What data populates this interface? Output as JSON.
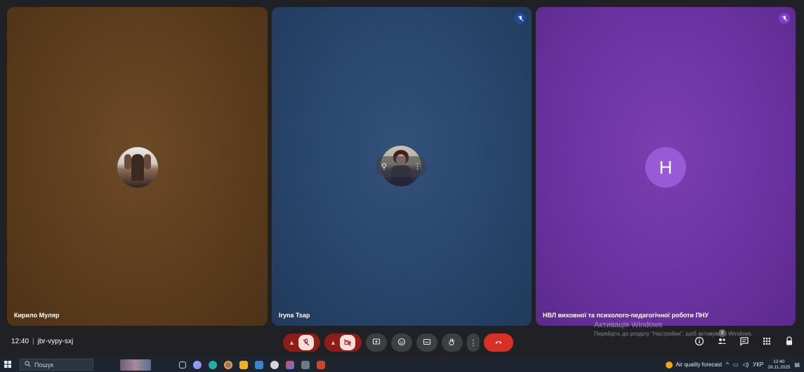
{
  "participants": [
    {
      "name": "Кирило Муляр",
      "muted": false,
      "avatar": "photo-man"
    },
    {
      "name": "Iryna Tsap",
      "muted": true,
      "avatar": "photo-woman"
    },
    {
      "name": "НВЛ виховної та психолого-педагогічної роботи ПНУ",
      "muted": true,
      "avatar_letter": "Н"
    }
  ],
  "meeting": {
    "time": "12:40",
    "separator": "|",
    "code": "jbr-vypy-sxj"
  },
  "controls": [
    "mic-off",
    "camera-off",
    "present",
    "emoji",
    "captions",
    "raise-hand",
    "more",
    "leave-call"
  ],
  "right_panel": {
    "people_count": "3"
  },
  "watermark": {
    "title": "Активація Windows",
    "subtitle": "Перейдіть до розділу \"Настройки\", щоб активувати Windows."
  },
  "taskbar": {
    "search_placeholder": "Пошук",
    "weather_label": "Air quality forecast",
    "language": "УКР",
    "clock_time": "12:40",
    "clock_date": "28.11.2025"
  },
  "colors": {
    "tile1": "#5a3b1c",
    "tile2": "#284469",
    "tile3": "#6a32a0",
    "hangup": "#d93025",
    "mute_red": "#8c1d18"
  }
}
